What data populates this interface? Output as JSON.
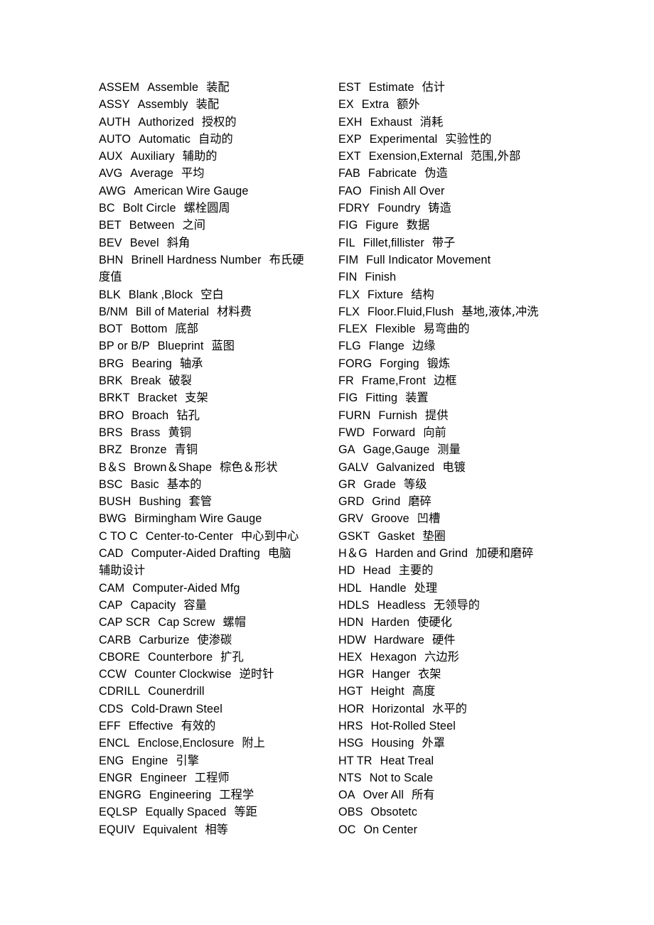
{
  "document": {
    "type": "glossary",
    "title_visible": false,
    "background_color": "#ffffff",
    "text_color": "#000000",
    "columns": 2,
    "lines_per_column": 44
  },
  "left_column": [
    {
      "abbr": "ASSEM",
      "english": "Assemble",
      "chinese": "装配"
    },
    {
      "abbr": "ASSY",
      "english": "Assembly",
      "chinese": "装配"
    },
    {
      "abbr": "AUTH",
      "english": "Authorized",
      "chinese": "授权的"
    },
    {
      "abbr": "AUTO",
      "english": "Automatic",
      "chinese": "自动的"
    },
    {
      "abbr": "AUX",
      "english": "Auxiliary",
      "chinese": "辅助的"
    },
    {
      "abbr": "AVG",
      "english": "Average",
      "chinese": "平均"
    },
    {
      "abbr": "AWG",
      "english": "American Wire Gauge",
      "chinese": ""
    },
    {
      "abbr": "BC",
      "english": "Bolt Circle",
      "chinese": "螺栓圆周"
    },
    {
      "abbr": "BET",
      "english": "Between",
      "chinese": "之间"
    },
    {
      "abbr": "BEV",
      "english": "Bevel",
      "chinese": "斜角"
    },
    {
      "abbr": "BHN",
      "english": "Brinell Hardness Number",
      "chinese": "布氏硬"
    },
    {
      "abbr": "",
      "english": "",
      "chinese": "度值",
      "continuation": true
    },
    {
      "abbr": "BLK",
      "english": "Blank ,Block",
      "chinese": "空白"
    },
    {
      "abbr": "B/NM",
      "english": "Bill of Material",
      "chinese": "材料费"
    },
    {
      "abbr": "BOT",
      "english": "Bottom",
      "chinese": "底部"
    },
    {
      "abbr": "BP or B/P",
      "english": "Blueprint",
      "chinese": "蓝图"
    },
    {
      "abbr": "BRG",
      "english": "Bearing",
      "chinese": "轴承"
    },
    {
      "abbr": "BRK",
      "english": "Break",
      "chinese": "破裂"
    },
    {
      "abbr": "BRKT",
      "english": "Bracket",
      "chinese": "支架"
    },
    {
      "abbr": "BRO",
      "english": "Broach",
      "chinese": "钻孔"
    },
    {
      "abbr": "BRS",
      "english": "Brass",
      "chinese": "黄铜"
    },
    {
      "abbr": "BRZ",
      "english": "Bronze",
      "chinese": "青铜"
    },
    {
      "abbr": "B＆S",
      "english": "Brown＆Shape",
      "chinese": "棕色＆形状"
    },
    {
      "abbr": "BSC",
      "english": "Basic",
      "chinese": "基本的"
    },
    {
      "abbr": "BUSH",
      "english": "Bushing",
      "chinese": "套管"
    },
    {
      "abbr": "BWG",
      "english": "Birmingham Wire Gauge",
      "chinese": ""
    },
    {
      "abbr": "C TO C",
      "english": "Center-to-Center",
      "chinese": "中心到中心"
    },
    {
      "abbr": "CAD",
      "english": "Computer-Aided Drafting",
      "chinese": "电脑"
    },
    {
      "abbr": "",
      "english": "",
      "chinese": "辅助设计",
      "continuation": true
    },
    {
      "abbr": "CAM",
      "english": "Computer-Aided Mfg",
      "chinese": ""
    },
    {
      "abbr": "CAP",
      "english": "Capacity",
      "chinese": "容量"
    },
    {
      "abbr": "CAP SCR",
      "english": "Cap Screw",
      "chinese": "螺帽"
    },
    {
      "abbr": "CARB",
      "english": "Carburize",
      "chinese": "使渗碳"
    },
    {
      "abbr": "CBORE",
      "english": "Counterbore",
      "chinese": "扩孔"
    },
    {
      "abbr": "CCW",
      "english": "Counter Clockwise",
      "chinese": "逆时针"
    },
    {
      "abbr": "CDRILL",
      "english": "Counerdrill",
      "chinese": ""
    },
    {
      "abbr": "CDS",
      "english": "Cold-Drawn Steel",
      "chinese": ""
    },
    {
      "abbr": "EFF",
      "english": "Effective",
      "chinese": "有效的"
    },
    {
      "abbr": "ENCL",
      "english": "Enclose,Enclosure",
      "chinese": "附上"
    },
    {
      "abbr": "ENG",
      "english": "Engine",
      "chinese": "引擎"
    },
    {
      "abbr": "ENGR",
      "english": "Engineer",
      "chinese": "工程师"
    },
    {
      "abbr": "ENGRG",
      "english": "Engineering",
      "chinese": "工程学"
    },
    {
      "abbr": "EQLSP",
      "english": "Equally Spaced",
      "chinese": "等距"
    },
    {
      "abbr": "EQUIV",
      "english": "Equivalent",
      "chinese": "相等"
    }
  ],
  "right_column": [
    {
      "abbr": "EST",
      "english": "Estimate",
      "chinese": "估计"
    },
    {
      "abbr": "EX",
      "english": "Extra",
      "chinese": "额外"
    },
    {
      "abbr": "EXH",
      "english": "Exhaust",
      "chinese": "消耗"
    },
    {
      "abbr": "EXP",
      "english": "Experimental",
      "chinese": "实验性的"
    },
    {
      "abbr": "EXT",
      "english": "Exension,External",
      "chinese": "范围,外部"
    },
    {
      "abbr": "FAB",
      "english": "Fabricate",
      "chinese": "伪造"
    },
    {
      "abbr": "FAO",
      "english": "Finish All Over",
      "chinese": ""
    },
    {
      "abbr": "FDRY",
      "english": "Foundry",
      "chinese": "铸造"
    },
    {
      "abbr": "FIG",
      "english": "Figure",
      "chinese": "数据"
    },
    {
      "abbr": "FIL",
      "english": "Fillet,fillister",
      "chinese": "带子"
    },
    {
      "abbr": "FIM",
      "english": "Full Indicator Movement",
      "chinese": ""
    },
    {
      "abbr": "FIN",
      "english": "Finish",
      "chinese": ""
    },
    {
      "abbr": "FLX",
      "english": "Fixture",
      "chinese": "结构"
    },
    {
      "abbr": "FLX",
      "english": "Floor.Fluid,Flush",
      "chinese": "基地,液体,冲洗"
    },
    {
      "abbr": "FLEX",
      "english": "Flexible",
      "chinese": "易弯曲的"
    },
    {
      "abbr": "FLG",
      "english": "Flange",
      "chinese": "边缘"
    },
    {
      "abbr": "FORG",
      "english": "Forging",
      "chinese": "锻炼"
    },
    {
      "abbr": "FR",
      "english": "Frame,Front",
      "chinese": "边框"
    },
    {
      "abbr": "FIG",
      "english": "Fitting",
      "chinese": "装置"
    },
    {
      "abbr": "FURN",
      "english": "Furnish",
      "chinese": "提供"
    },
    {
      "abbr": "FWD",
      "english": "Forward",
      "chinese": "向前"
    },
    {
      "abbr": "GA",
      "english": "Gage,Gauge",
      "chinese": "测量"
    },
    {
      "abbr": "GALV",
      "english": "Galvanized",
      "chinese": "电镀"
    },
    {
      "abbr": "GR",
      "english": "Grade",
      "chinese": "等级"
    },
    {
      "abbr": "GRD",
      "english": "Grind",
      "chinese": "磨碎"
    },
    {
      "abbr": "GRV",
      "english": "Groove",
      "chinese": "凹槽"
    },
    {
      "abbr": "GSKT",
      "english": "Gasket",
      "chinese": "垫圈"
    },
    {
      "abbr": "H＆G",
      "english": "Harden and Grind",
      "chinese": "加硬和磨碎"
    },
    {
      "abbr": "HD",
      "english": "Head",
      "chinese": "主要的"
    },
    {
      "abbr": "HDL",
      "english": "Handle",
      "chinese": "处理"
    },
    {
      "abbr": "HDLS",
      "english": "Headless",
      "chinese": "无领导的"
    },
    {
      "abbr": "HDN",
      "english": "Harden",
      "chinese": "使硬化"
    },
    {
      "abbr": "HDW",
      "english": "Hardware",
      "chinese": "硬件"
    },
    {
      "abbr": "HEX",
      "english": "Hexagon",
      "chinese": "六边形"
    },
    {
      "abbr": "HGR",
      "english": "Hanger",
      "chinese": "衣架"
    },
    {
      "abbr": "HGT",
      "english": "Height",
      "chinese": "高度"
    },
    {
      "abbr": "HOR",
      "english": "Horizontal",
      "chinese": "水平的"
    },
    {
      "abbr": "HRS",
      "english": "Hot-Rolled Steel",
      "chinese": ""
    },
    {
      "abbr": "HSG",
      "english": "Housing",
      "chinese": "外罩"
    },
    {
      "abbr": "HT TR",
      "english": "Heat Treal",
      "chinese": ""
    },
    {
      "abbr": "NTS",
      "english": "Not to Scale",
      "chinese": ""
    },
    {
      "abbr": "OA",
      "english": "Over All",
      "chinese": "所有"
    },
    {
      "abbr": "OBS",
      "english": "Obsotetc",
      "chinese": ""
    },
    {
      "abbr": "OC",
      "english": "On Center",
      "chinese": ""
    }
  ]
}
